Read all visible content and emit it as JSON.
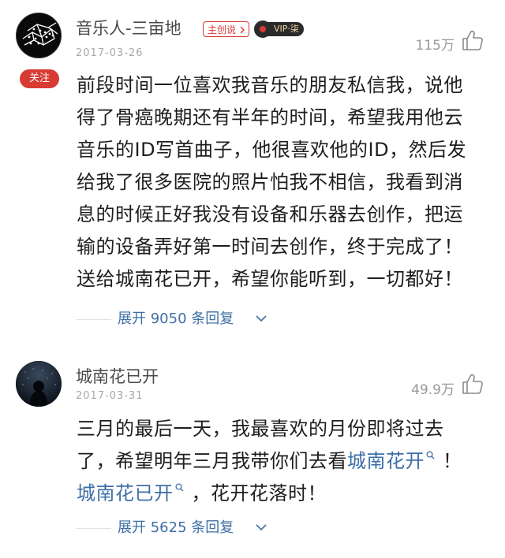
{
  "comments": [
    {
      "username": "音乐人-三亩地",
      "date": "2017-03-26",
      "follow_label": "关注",
      "creator_tag": "主创说",
      "vip_label": "VIP·柒",
      "likes": "115万",
      "lines": [
        "前段时间一位喜欢我音乐的朋友私信我，说他",
        "得了骨癌晚期还有半年的时间，希望我用他云",
        "音乐的ID写首曲子，他很喜欢他的ID，然后发",
        "给我了很多医院的照片怕我不相信，我看到消",
        "息的时候正好我没有设备和乐器去创作，把运",
        "输的设备弄好第一时间去创作，终于完成了！",
        "送给城南花已开，希望你能听到，一切都好！"
      ],
      "reply_label": "展开 9050 条回复"
    },
    {
      "username": "城南花已开",
      "date": "2017-03-31",
      "likes": "49.9万",
      "line1": "三月的最后一天，我最喜欢的月份即将过去",
      "line2_prefix": "了，希望明年三月我带你们去看",
      "line2_link": "城南花开",
      "line2_suffix": "！",
      "line3_link": "城南花已开",
      "line3_suffix": "，花开花落时！",
      "reply_label": "展开 5625 条回复"
    }
  ],
  "icons": {
    "like": "thumbs-up-icon",
    "search": "search-icon",
    "expand": "chevron-down-icon",
    "vip": "vinyl-record-icon"
  },
  "colors": {
    "accent_red": "#d83a34",
    "link_blue": "#3f6fa6",
    "muted_gray": "#9a9a9a"
  }
}
